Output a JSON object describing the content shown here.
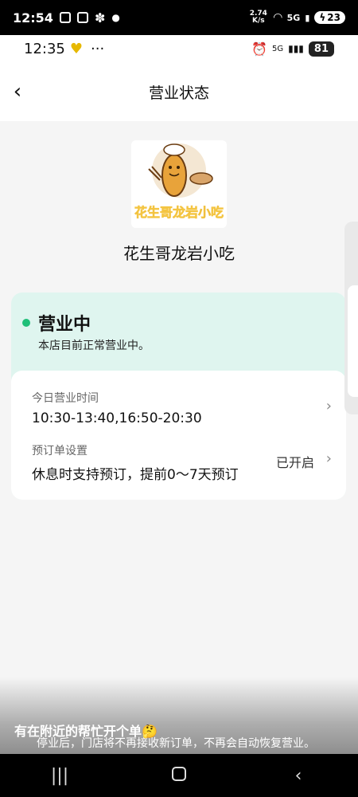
{
  "system_status": {
    "time": "12:54",
    "net_speed": "2.74 K/s",
    "network": "5G",
    "battery": "23"
  },
  "app_status": {
    "time": "12:35",
    "network": "5G",
    "battery": "81"
  },
  "header": {
    "title": "营业状态",
    "back_icon": "chevron-left-icon"
  },
  "shop": {
    "logo_text": "花生哥龙岩小吃",
    "name": "花生哥龙岩小吃"
  },
  "status": {
    "title": "营业中",
    "description": "本店目前正常营业中。",
    "accent": "#1fbf78"
  },
  "hours": {
    "label": "今日营业时间",
    "value": "10:30-13:40,16:50-20:30"
  },
  "preorder": {
    "label": "预订单设置",
    "value": "休息时支持预订，提前0～7天预订",
    "status": "已开启"
  },
  "footer": {
    "notice": "停业后，门店将不再接收新订单，不再会自动恢复营业。",
    "toast": "有在附近的帮忙开个单🤔"
  }
}
